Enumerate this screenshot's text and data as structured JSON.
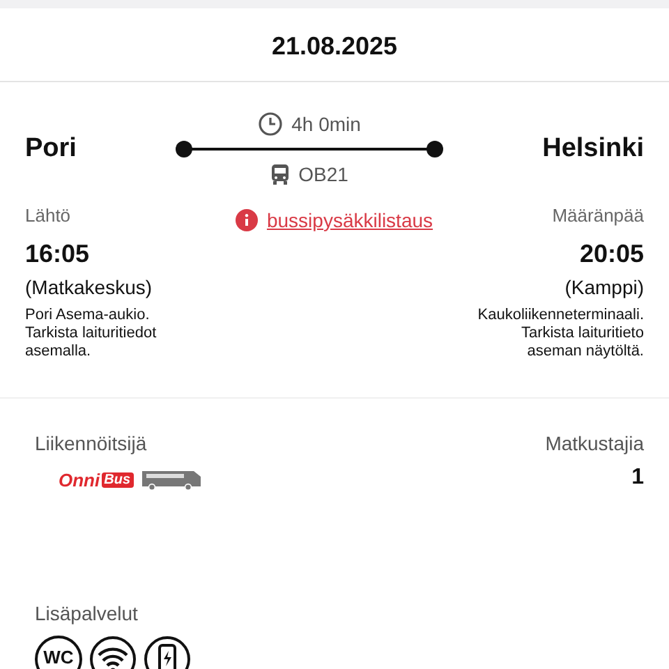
{
  "date": "21.08.2025",
  "route": {
    "origin": "Pori",
    "destination": "Helsinki",
    "duration": "4h 0min",
    "line": "OB21"
  },
  "departure": {
    "label": "Lähtö",
    "time": "16:05",
    "station": "(Matkakeskus)",
    "note": "Pori Asema-aukio. Tarkista laituritiedot asemalla."
  },
  "stop_list_link": "bussipysäkkilistaus",
  "arrival": {
    "label": "Määränpää",
    "time": "20:05",
    "station": "(Kamppi)",
    "note": "Kaukoliikenneterminaali. Tarkista laituritieto aseman näytöltä."
  },
  "operator": {
    "label": "Liikennöitsijä",
    "logo_text": "Onni",
    "logo_badge": "Bus"
  },
  "passengers": {
    "label": "Matkustajia",
    "count": "1"
  },
  "extras": {
    "label": "Lisäpalvelut",
    "services": [
      {
        "kind": "wc",
        "text": "WC"
      },
      {
        "kind": "wifi"
      },
      {
        "kind": "charging"
      }
    ]
  }
}
